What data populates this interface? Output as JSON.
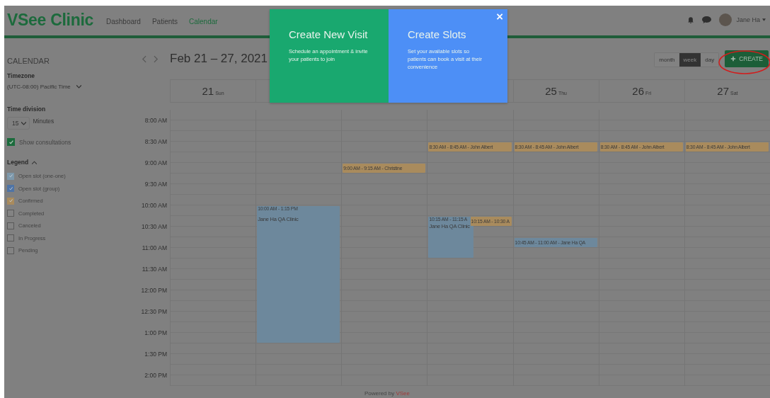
{
  "header": {
    "brand": "VSee Clinic",
    "nav": [
      {
        "label": "Dashboard",
        "selected": false
      },
      {
        "label": "Patients",
        "selected": false
      },
      {
        "label": "Calendar",
        "selected": true
      }
    ],
    "user": "Jane Ha"
  },
  "sidebar": {
    "title": "CALENDAR",
    "timezone_label": "Timezone",
    "timezone": "(UTC-08:00) Pacific Time",
    "division_label": "Time division",
    "division": "15",
    "division_unit": "Minutes",
    "show_consultations": {
      "label": "Show consultations",
      "checked": true
    },
    "legend_title": "Legend",
    "legend": [
      {
        "label": "Open slot (one-one)",
        "checked": true,
        "color": "#7d98ab"
      },
      {
        "label": "Open slot (group)",
        "checked": true,
        "color": "#4f74a6"
      },
      {
        "label": "Confirmed",
        "checked": true,
        "color": "#a98b5d"
      },
      {
        "label": "Completed",
        "checked": false
      },
      {
        "label": "Canceled",
        "checked": false
      },
      {
        "label": "In Progress",
        "checked": false
      },
      {
        "label": "Pending",
        "checked": false
      }
    ]
  },
  "toolbar": {
    "range": "Feb 21 – 27, 2021",
    "views": [
      {
        "label": "month",
        "selected": false
      },
      {
        "label": "week",
        "selected": true
      },
      {
        "label": "day",
        "selected": false
      }
    ],
    "create": "CREATE"
  },
  "days": [
    {
      "number": "21",
      "weekday": "Sun"
    },
    {
      "number": "25",
      "weekday": "Thu"
    },
    {
      "number": "26",
      "weekday": "Fri"
    },
    {
      "number": "27",
      "weekday": "Sat"
    }
  ],
  "times": [
    "8:00 AM",
    "8:30 AM",
    "9:00 AM",
    "9:30 AM",
    "10:00 AM",
    "10:30 AM",
    "11:00 AM",
    "11:30 AM",
    "12:00 PM",
    "12:30 PM",
    "1:00 PM",
    "1:30 PM",
    "2:00 PM"
  ],
  "events": [
    {
      "kind": "appointment",
      "text": "8:30 AM - 8:45 AM - John Albert"
    },
    {
      "kind": "appointment",
      "text": "8:30 AM - 8:45 AM - John Albert"
    },
    {
      "kind": "appointment",
      "text": "8:30 AM - 8:45 AM - John Albert"
    },
    {
      "kind": "appointment",
      "text": "8:30 AM - 8:45 AM - John Albert"
    },
    {
      "kind": "appointment",
      "text": "9:00 AM - 9:15 AM - Christine"
    },
    {
      "kind": "slot",
      "text": "10:00 AM - 1:15 PM",
      "title": "Jane Ha QA Clinic"
    },
    {
      "kind": "slot",
      "text": "10:15 AM - 11:15 A",
      "title": "Jane Ha QA Clinic"
    },
    {
      "kind": "appointment",
      "text": "10:15 AM - 10:30 A"
    },
    {
      "kind": "slot",
      "text": "10:45 AM - 11:00 AM - Jane Ha QA"
    }
  ],
  "popup": {
    "options": [
      {
        "kind": "visit",
        "title": "Create New Visit",
        "text": "Schedule an appointment & invite your patients to join"
      },
      {
        "kind": "slots",
        "title": "Create Slots",
        "text": "Set your available slots so patients can book a visit at their convenience"
      }
    ],
    "close": "×"
  },
  "footer": {
    "text": "Powered by",
    "brand": "VSee"
  }
}
